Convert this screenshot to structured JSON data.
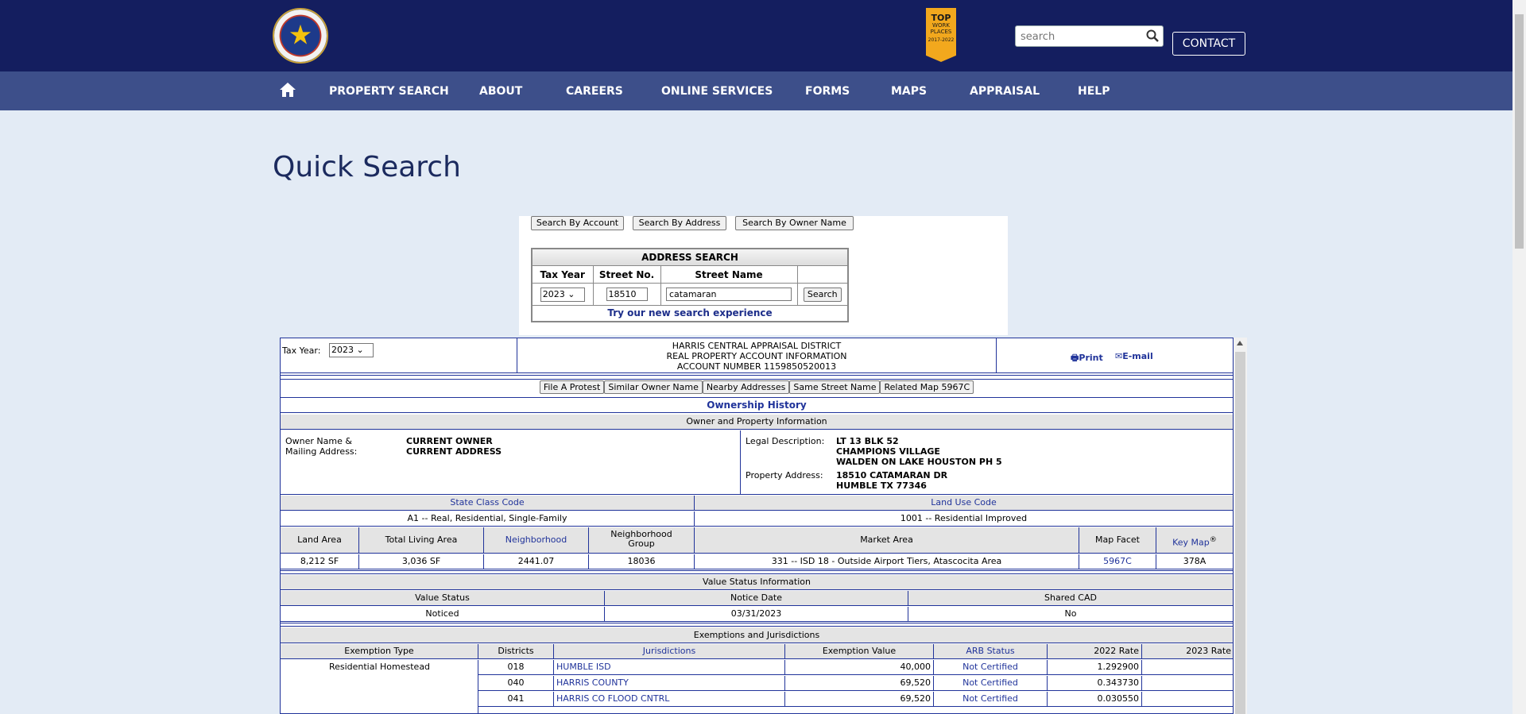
{
  "header": {
    "badge_top": "TOP",
    "badge_mid": "WORK PLACES",
    "badge_years": "2017-2022",
    "search_placeholder": "search",
    "contact": "CONTACT"
  },
  "nav": [
    "PROPERTY SEARCH",
    "ABOUT",
    "CAREERS",
    "ONLINE SERVICES",
    "FORMS",
    "MAPS",
    "APPRAISAL",
    "HELP"
  ],
  "page_title": "Quick Search",
  "search_tabs": [
    "Search By Account",
    "Search By Address",
    "Search By Owner Name"
  ],
  "address_search": {
    "title": "ADDRESS SEARCH",
    "headers": [
      "Tax Year",
      "Street No.",
      "Street Name",
      ""
    ],
    "tax_year": "2023",
    "street_no": "18510",
    "street_name": "catamaran",
    "search_btn": "Search",
    "new_search_link": "Try our new search experience"
  },
  "account": {
    "tax_year_label": "Tax Year:",
    "tax_year": "2023",
    "line1": "HARRIS CENTRAL APPRAISAL DISTRICT",
    "line2": "REAL PROPERTY ACCOUNT INFORMATION",
    "line3": "ACCOUNT NUMBER 1159850520013",
    "print": "Print",
    "email": "E-mail"
  },
  "action_buttons": [
    "File A Protest",
    "Similar Owner Name",
    "Nearby Addresses",
    "Same Street Name",
    "Related Map 5967C"
  ],
  "ownership_history": "Ownership History",
  "owner_section": {
    "title": "Owner and Property Information",
    "owner_label1": "Owner Name &",
    "owner_label2": "Mailing Address:",
    "owner_name": "CURRENT OWNER",
    "owner_address": "CURRENT ADDRESS",
    "legal_label": "Legal Description:",
    "legal1": "LT 13 BLK 52",
    "legal2": "CHAMPIONS VILLAGE",
    "legal3": "WALDEN ON LAKE HOUSTON PH 5",
    "prop_label": "Property Address:",
    "prop1": "18510 CATAMARAN DR",
    "prop2": "HUMBLE TX 77346"
  },
  "class_codes": {
    "state_class_label": "State Class Code",
    "state_class": "A1 -- Real, Residential, Single-Family",
    "land_use_label": "Land Use Code",
    "land_use": "1001 -- Residential Improved"
  },
  "land_table": {
    "headers": [
      "Land Area",
      "Total Living Area",
      "Neighborhood",
      "Neighborhood Group",
      "Market Area",
      "Map Facet",
      "Key Map"
    ],
    "key_map_mark": "®",
    "values": [
      "8,212 SF",
      "3,036 SF",
      "2441.07",
      "18036",
      "331 -- ISD 18 - Outside Airport Tiers, Atascocita Area",
      "5967C",
      "378A"
    ]
  },
  "value_status": {
    "title": "Value Status Information",
    "headers": [
      "Value Status",
      "Notice Date",
      "Shared CAD"
    ],
    "values": [
      "Noticed",
      "03/31/2023",
      "No"
    ]
  },
  "exemptions": {
    "title": "Exemptions and Jurisdictions",
    "headers": [
      "Exemption Type",
      "Districts",
      "Jurisdictions",
      "Exemption Value",
      "ARB Status",
      "2022 Rate",
      "2023 Rate"
    ],
    "exemption_type": "Residential Homestead",
    "rows": [
      {
        "district": "018",
        "jurisdiction": "HUMBLE ISD",
        "value": "40,000",
        "arb": "Not Certified",
        "rate2022": "1.292900",
        "rate2023": ""
      },
      {
        "district": "040",
        "jurisdiction": "HARRIS COUNTY",
        "value": "69,520",
        "arb": "Not Certified",
        "rate2022": "0.343730",
        "rate2023": ""
      },
      {
        "district": "041",
        "jurisdiction": "HARRIS CO FLOOD CNTRL",
        "value": "69,520",
        "arb": "Not Certified",
        "rate2022": "0.030550",
        "rate2023": ""
      }
    ]
  }
}
